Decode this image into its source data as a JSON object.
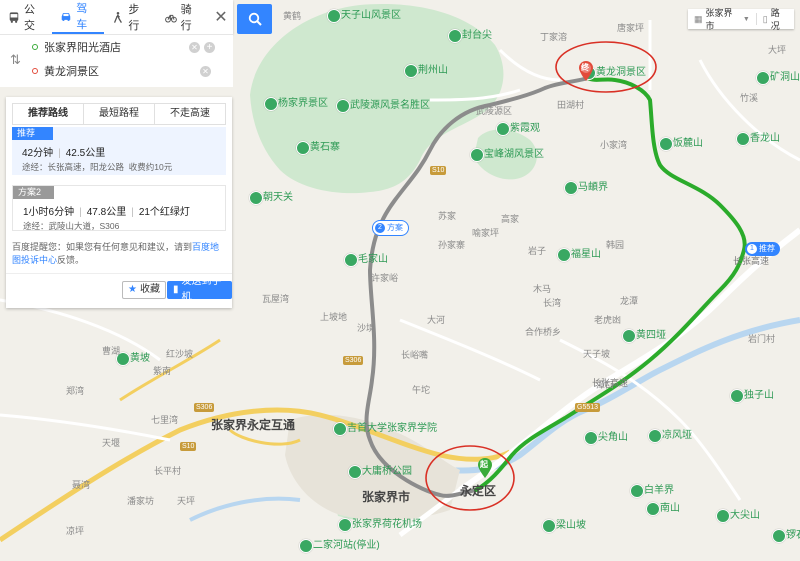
{
  "modes": [
    {
      "label": "公交",
      "icon": "bus-icon"
    },
    {
      "label": "驾车",
      "icon": "car-icon",
      "active": true
    },
    {
      "label": "步行",
      "icon": "walk-icon"
    },
    {
      "label": "骑行",
      "icon": "bike-icon"
    }
  ],
  "route": {
    "origin": "张家界阳光酒店",
    "destination": "黄龙洞景区"
  },
  "tabs": [
    {
      "label": "推荐路线",
      "active": true
    },
    {
      "label": "最短路程"
    },
    {
      "label": "不走高速"
    }
  ],
  "plans": [
    {
      "tag": "推荐",
      "time": "42分钟",
      "distance": "42.5公里",
      "via": "途经：长张高速，阳龙公路",
      "toll": "收费约10元"
    },
    {
      "tag": "方案2",
      "time": "1小时6分钟",
      "distance": "47.8公里",
      "lights": "21个红绿灯",
      "via": "途经：武陵山大道，S306"
    }
  ],
  "feedback": {
    "prefix": "百度提醒您：如果您有任何意见和建议，请到",
    "link": "百度地图投诉中心",
    "suffix": "反馈。"
  },
  "buttons": {
    "favorite": "收藏",
    "send": "发送到手机"
  },
  "topright": {
    "city": "张家界市",
    "traffic": "路况"
  },
  "route_badges": {
    "recommended": "推荐",
    "alt": "方案",
    "rec_num": "1",
    "alt_num": "2"
  },
  "markers": {
    "start": "起",
    "end": "终"
  },
  "colors": {
    "accent": "#3385ff",
    "route_main": "#2bab2b",
    "route_alt": "#8c8c8c",
    "highlight_circle": "#d93025",
    "green_area": "#c8e6c9"
  },
  "map_labels": {
    "poi": [
      {
        "t": "天子山风景区"
      },
      {
        "t": "封台尖"
      },
      {
        "t": "荆州山"
      },
      {
        "t": "杨家界景区"
      },
      {
        "t": "武陵源风景名胜区"
      },
      {
        "t": "黄石寨"
      },
      {
        "t": "紫霞观"
      },
      {
        "t": "宝峰湖风景区"
      },
      {
        "t": "朝天关"
      },
      {
        "t": "毛家山"
      },
      {
        "t": "黄龙洞景区"
      },
      {
        "t": "饭麓山"
      },
      {
        "t": "马頔界"
      },
      {
        "t": "福星山"
      },
      {
        "t": "黄四垭"
      },
      {
        "t": "香龙山"
      },
      {
        "t": "矿洞山"
      },
      {
        "t": "独子山"
      },
      {
        "t": "尖角山"
      },
      {
        "t": "凉风垭"
      },
      {
        "t": "白羊界"
      },
      {
        "t": "南山"
      },
      {
        "t": "大尖山"
      },
      {
        "t": "梁山坡"
      },
      {
        "t": "黄坡"
      },
      {
        "t": "大庸桥公园"
      },
      {
        "t": "吉首大学张家界学院"
      },
      {
        "t": "张家界荷花机场"
      },
      {
        "t": "二家河站(停业)"
      },
      {
        "t": "锣石"
      }
    ],
    "places": [
      {
        "t": "黄鹤"
      },
      {
        "t": "丁家溶"
      },
      {
        "t": "唐家坪"
      },
      {
        "t": "大坪"
      },
      {
        "t": "武陵源区"
      },
      {
        "t": "田湖村"
      },
      {
        "t": "小家湾"
      },
      {
        "t": "竹溪"
      },
      {
        "t": "喻家坪"
      },
      {
        "t": "苏家"
      },
      {
        "t": "高家"
      },
      {
        "t": "韩园"
      },
      {
        "t": "许家峪"
      },
      {
        "t": "长湾"
      },
      {
        "t": "木马"
      },
      {
        "t": "孙家寨"
      },
      {
        "t": "大河"
      },
      {
        "t": "合作桥乡"
      },
      {
        "t": "老虎凼"
      },
      {
        "t": "沙境"
      },
      {
        "t": "上坡地"
      },
      {
        "t": "长峪嘴"
      },
      {
        "t": "天子坡"
      },
      {
        "t": "岩门村"
      },
      {
        "t": "午坨"
      },
      {
        "t": "紫南"
      },
      {
        "t": "天堰"
      },
      {
        "t": "郑湾"
      },
      {
        "t": "红沙坡"
      },
      {
        "t": "七里湾"
      },
      {
        "t": "瓦屋湾"
      },
      {
        "t": "曹湖"
      },
      {
        "t": "聂湾"
      },
      {
        "t": "潘家坊"
      },
      {
        "t": "长平村"
      },
      {
        "t": "凉坪"
      },
      {
        "t": "天坪"
      },
      {
        "t": "岩子"
      },
      {
        "t": "龙潭"
      },
      {
        "t": "潭口"
      }
    ],
    "cities": [
      {
        "t": "张家界市"
      },
      {
        "t": "永定区"
      },
      {
        "t": "张家界永定互通"
      }
    ],
    "roads": [
      {
        "t": "S306"
      },
      {
        "t": "S306"
      },
      {
        "t": "S10"
      },
      {
        "t": "S10"
      },
      {
        "t": "G5513"
      },
      {
        "t": "长张高速"
      },
      {
        "t": "长张高速"
      }
    ]
  }
}
